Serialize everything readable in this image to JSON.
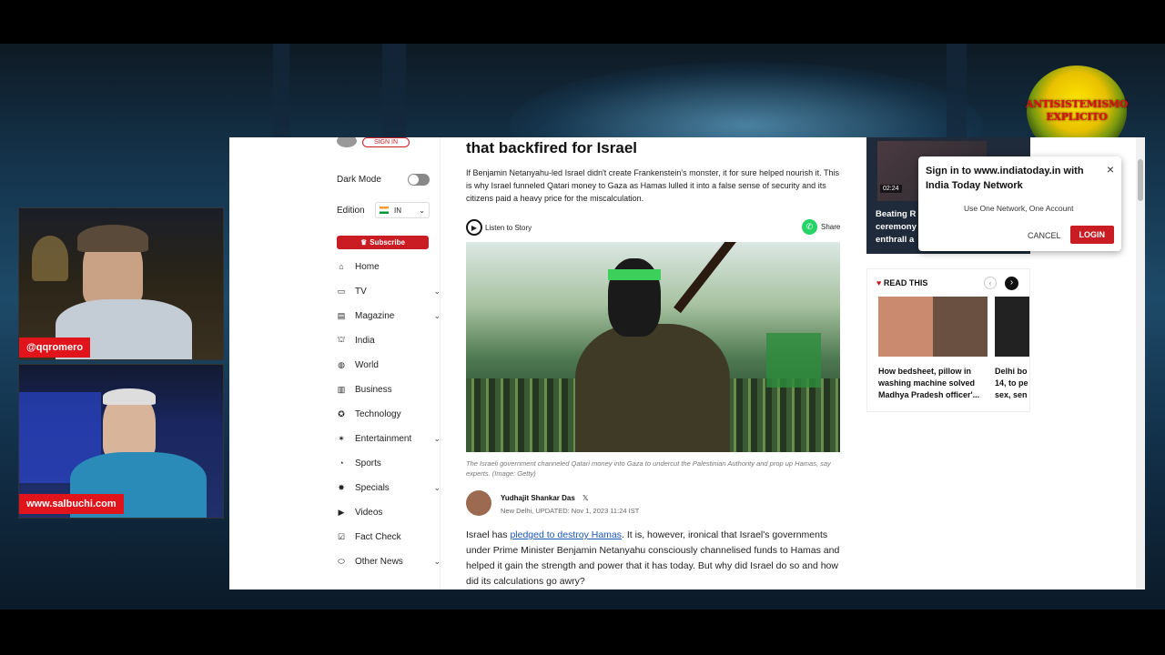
{
  "logo": {
    "line1": "ANTISISTEMISMO",
    "line2": "EXPLICITO"
  },
  "cams": [
    {
      "handle": "@qqromero"
    },
    {
      "handle": "www.salbuchi.com"
    }
  ],
  "site": {
    "sign_in": "SIGN IN",
    "dark_mode_label": "Dark Mode",
    "edition_label": "Edition",
    "edition_value": "IN",
    "subscribe": "Subscribe",
    "nav": [
      {
        "label": "Home",
        "icon": "⌂"
      },
      {
        "label": "TV",
        "icon": "▭",
        "chevron": "⌄"
      },
      {
        "label": "Magazine",
        "icon": "▤",
        "chevron": "⌄"
      },
      {
        "label": "India",
        "icon": "⛫"
      },
      {
        "label": "World",
        "icon": "◍"
      },
      {
        "label": "Business",
        "icon": "▥"
      },
      {
        "label": "Technology",
        "icon": "✪"
      },
      {
        "label": "Entertainment",
        "icon": "✶",
        "chevron": "⌄"
      },
      {
        "label": "Sports",
        "icon": "◔"
      },
      {
        "label": "Specials",
        "icon": "✸",
        "chevron": "⌄"
      },
      {
        "label": "Videos",
        "icon": "▶"
      },
      {
        "label": "Fact Check",
        "icon": "☑"
      },
      {
        "label": "Other News",
        "icon": "⬭",
        "chevron": "⌄"
      }
    ]
  },
  "article": {
    "headline": "that backfired for Israel",
    "summary": "If Benjamin Netanyahu-led Israel didn't create Frankenstein's monster, it for sure helped nourish it. This is why Israel funneled Qatari money to Gaza as Hamas lulled it into a false sense of security and its citizens paid a heavy price for the miscalculation.",
    "listen": "Listen to Story",
    "share": "Share",
    "caption": "The Israeli government channeled Qatari money into Gaza to undercut the Palestinian Authority and prop up Hamas, say experts. (Image: Getty)",
    "author": "Yudhajit Shankar Das",
    "author_x": "𝕏",
    "dateline": "New Delhi, UPDATED: Nov 1, 2023 11:24 IST",
    "body_pre": "Israel has ",
    "body_link": "pledged to destroy Hamas",
    "body_post": ". It is, however, ironical that Israel's governments under Prime Minister Benjamin Netanyahu consciously channelised funds to Hamas and helped it gain the strength and power that it has today. But why did Israel do so and how did its calculations go awry?"
  },
  "right": {
    "video_time": "02:24",
    "video_title": "Beating R ceremony enthrall a",
    "read_this": "READ THIS",
    "cards": [
      {
        "title": "How bedsheet, pillow in washing machine solved Madhya Pradesh officer'..."
      },
      {
        "title": "Delhi bo 14, to pe sex, sen"
      }
    ]
  },
  "popup": {
    "title": "Sign in to www.indiatoday.in with India Today Network",
    "subtitle": "Use One Network, One Account",
    "cancel": "CANCEL",
    "login": "LOGIN",
    "close": "×"
  },
  "colors": {
    "accent": "#c91d23",
    "link": "#1a56b8"
  }
}
